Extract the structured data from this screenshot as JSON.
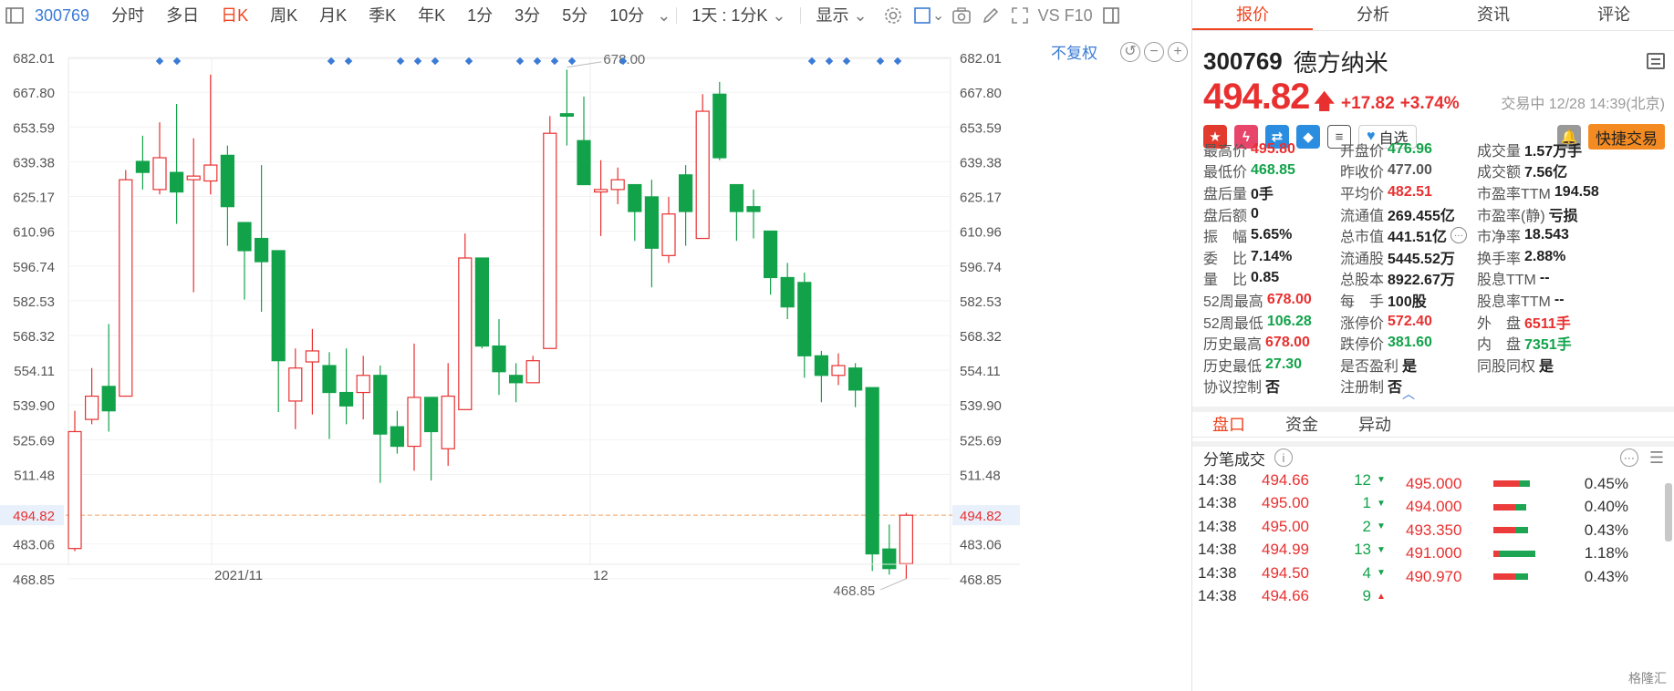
{
  "toolbar": {
    "code": "300769",
    "items": [
      "分时",
      "多日",
      "日K",
      "周K",
      "月K",
      "季K",
      "年K",
      "1分",
      "3分",
      "5分",
      "10分"
    ],
    "active_item": "日K",
    "interval_select": "1天 : 1分K",
    "display_select": "显示",
    "vs_label": "VS F10"
  },
  "chart": {
    "adjust_label": "不复权",
    "price_marker": "494.82",
    "high_label": "678.00",
    "low_label": "468.85",
    "date_labels": [
      "2021/11",
      "12"
    ],
    "y_ticks": [
      "682.01",
      "667.80",
      "653.59",
      "639.38",
      "625.17",
      "610.96",
      "596.74",
      "582.53",
      "568.32",
      "554.11",
      "539.90",
      "525.69",
      "511.48",
      "494.82",
      "483.06",
      "468.85"
    ],
    "colors": {
      "up": "#e93030",
      "down": "#12a34a",
      "marker": "#f0a060",
      "event_dot": "#3a7bd5"
    }
  },
  "chart_data": {
    "type": "candlestick",
    "current_price": 494.82,
    "ylim": [
      461.7,
      689.1
    ],
    "candles": [
      {
        "o": 481.2,
        "h": 537.5,
        "l": 480.1,
        "c": 529.0
      },
      {
        "o": 534.0,
        "h": 555.0,
        "l": 532.0,
        "c": 543.5
      },
      {
        "o": 547.5,
        "h": 573.0,
        "l": 529.0,
        "c": 537.5
      },
      {
        "o": 543.5,
        "h": 636.0,
        "l": 543.5,
        "c": 632.0
      },
      {
        "o": 639.5,
        "h": 650.0,
        "l": 628.0,
        "c": 635.0
      },
      {
        "o": 628.0,
        "h": 655.5,
        "l": 626.0,
        "c": 641.0
      },
      {
        "o": 635.0,
        "h": 663.0,
        "l": 614.0,
        "c": 627.0
      },
      {
        "o": 632.0,
        "h": 649.0,
        "l": 586.0,
        "c": 633.5
      },
      {
        "o": 631.5,
        "h": 675.0,
        "l": 626.0,
        "c": 638.0
      },
      {
        "o": 642.0,
        "h": 646.0,
        "l": 605.0,
        "c": 621.0
      },
      {
        "o": 614.5,
        "h": 614.5,
        "l": 583.0,
        "c": 603.0
      },
      {
        "o": 608.0,
        "h": 638.0,
        "l": 578.0,
        "c": 598.5
      },
      {
        "o": 603.0,
        "h": 603.0,
        "l": 537.0,
        "c": 558.0
      },
      {
        "o": 541.5,
        "h": 563.0,
        "l": 530.0,
        "c": 555.0
      },
      {
        "o": 557.5,
        "h": 571.0,
        "l": 536.0,
        "c": 562.0
      },
      {
        "o": 556.0,
        "h": 561.5,
        "l": 526.0,
        "c": 545.0
      },
      {
        "o": 545.0,
        "h": 563.0,
        "l": 532.0,
        "c": 539.5
      },
      {
        "o": 545.0,
        "h": 560.0,
        "l": 534.0,
        "c": 552.0
      },
      {
        "o": 552.0,
        "h": 556.0,
        "l": 508.0,
        "c": 528.0
      },
      {
        "o": 531.0,
        "h": 537.5,
        "l": 520.0,
        "c": 523.0
      },
      {
        "o": 523.0,
        "h": 565.0,
        "l": 513.0,
        "c": 543.0
      },
      {
        "o": 543.0,
        "h": 543.0,
        "l": 509.0,
        "c": 529.0
      },
      {
        "o": 522.0,
        "h": 557.0,
        "l": 515.0,
        "c": 543.5
      },
      {
        "o": 538.0,
        "h": 610.0,
        "l": 538.0,
        "c": 600.0
      },
      {
        "o": 600.0,
        "h": 600.0,
        "l": 563.0,
        "c": 564.0
      },
      {
        "o": 564.0,
        "h": 575.0,
        "l": 544.0,
        "c": 553.5
      },
      {
        "o": 552.0,
        "h": 557.0,
        "l": 541.0,
        "c": 549.0
      },
      {
        "o": 549.0,
        "h": 560.0,
        "l": 549.0,
        "c": 558.0
      },
      {
        "o": 563.0,
        "h": 658.0,
        "l": 563.0,
        "c": 651.0
      },
      {
        "o": 659.0,
        "h": 677.0,
        "l": 646.0,
        "c": 658.0
      },
      {
        "o": 648.0,
        "h": 666.0,
        "l": 630.0,
        "c": 630.0
      },
      {
        "o": 627.0,
        "h": 640.0,
        "l": 609.0,
        "c": 628.0
      },
      {
        "o": 628.0,
        "h": 637.0,
        "l": 622.0,
        "c": 632.0
      },
      {
        "o": 630.0,
        "h": 630.0,
        "l": 607.0,
        "c": 619.0
      },
      {
        "o": 625.0,
        "h": 632.0,
        "l": 588.0,
        "c": 604.0
      },
      {
        "o": 601.0,
        "h": 625.0,
        "l": 598.0,
        "c": 618.0
      },
      {
        "o": 634.0,
        "h": 638.0,
        "l": 605.0,
        "c": 619.0
      },
      {
        "o": 608.0,
        "h": 667.0,
        "l": 608.0,
        "c": 660.0
      },
      {
        "o": 667.0,
        "h": 672.0,
        "l": 640.0,
        "c": 641.0
      },
      {
        "o": 630.0,
        "h": 630.0,
        "l": 607.0,
        "c": 619.0
      },
      {
        "o": 621.0,
        "h": 628.0,
        "l": 608.0,
        "c": 619.0
      },
      {
        "o": 611.0,
        "h": 611.0,
        "l": 585.0,
        "c": 592.0
      },
      {
        "o": 592.0,
        "h": 598.0,
        "l": 575.0,
        "c": 580.0
      },
      {
        "o": 590.0,
        "h": 594.0,
        "l": 551.0,
        "c": 560.0
      },
      {
        "o": 560.0,
        "h": 562.0,
        "l": 541.0,
        "c": 552.0
      },
      {
        "o": 552.0,
        "h": 561.0,
        "l": 548.0,
        "c": 556.0
      },
      {
        "o": 555.0,
        "h": 557.0,
        "l": 539.0,
        "c": 546.0
      },
      {
        "o": 547.0,
        "h": 547.0,
        "l": 472.0,
        "c": 479.0
      },
      {
        "o": 481.0,
        "h": 491.0,
        "l": 470.5,
        "c": 473.0
      },
      {
        "o": 475.0,
        "h": 495.8,
        "l": 468.85,
        "c": 494.82
      }
    ]
  },
  "tabs": [
    "报价",
    "分析",
    "资讯",
    "评论"
  ],
  "active_tab": "报价",
  "stock": {
    "code": "300769",
    "name": "德方纳米",
    "price": "494.82",
    "change": "+17.82",
    "change_pct": "+3.74%",
    "status": "交易中 12/28 14:39(北京)",
    "fav_label": "自选",
    "quick_trade": "快捷交易"
  },
  "stats": [
    [
      {
        "label": "最高价",
        "value": "495.80",
        "tone": "up"
      },
      {
        "label": "开盘价",
        "value": "476.96",
        "tone": "down"
      },
      {
        "label": "成交量",
        "value": "1.57万手",
        "tone": ""
      }
    ],
    [
      {
        "label": "最低价",
        "value": "468.85",
        "tone": "down"
      },
      {
        "label": "昨收价",
        "value": "477.00",
        "tone": "flat"
      },
      {
        "label": "成交额",
        "value": "7.56亿",
        "tone": ""
      }
    ],
    [
      {
        "label": "盘后量",
        "value": "0手",
        "tone": ""
      },
      {
        "label": "平均价",
        "value": "482.51",
        "tone": "up"
      },
      {
        "label": "市盈率TTM",
        "value": "194.58",
        "tone": ""
      }
    ],
    [
      {
        "label": "盘后额",
        "value": "0",
        "tone": ""
      },
      {
        "label": "流通值",
        "value": "269.455亿",
        "tone": ""
      },
      {
        "label": "市盈率(静)",
        "value": "亏损",
        "tone": ""
      }
    ],
    [
      {
        "label": "振　幅",
        "value": "5.65%",
        "tone": ""
      },
      {
        "label": "总市值",
        "value": "441.51亿",
        "tone": ""
      },
      {
        "label": "市净率",
        "value": "18.543",
        "tone": ""
      }
    ],
    [
      {
        "label": "委　比",
        "value": "7.14%",
        "tone": ""
      },
      {
        "label": "流通股",
        "value": "5445.52万",
        "tone": ""
      },
      {
        "label": "换手率",
        "value": "2.88%",
        "tone": ""
      }
    ],
    [
      {
        "label": "量　比",
        "value": "0.85",
        "tone": ""
      },
      {
        "label": "总股本",
        "value": "8922.67万",
        "tone": ""
      },
      {
        "label": "股息TTM",
        "value": "--",
        "tone": ""
      }
    ],
    [
      {
        "label": "52周最高",
        "value": "678.00",
        "tone": "up"
      },
      {
        "label": "每　手",
        "value": "100股",
        "tone": ""
      },
      {
        "label": "股息率TTM",
        "value": "--",
        "tone": ""
      }
    ],
    [
      {
        "label": "52周最低",
        "value": "106.28",
        "tone": "down"
      },
      {
        "label": "涨停价",
        "value": "572.40",
        "tone": "up"
      },
      {
        "label": "外　盘",
        "value": "6511手",
        "tone": "up"
      }
    ],
    [
      {
        "label": "历史最高",
        "value": "678.00",
        "tone": "up"
      },
      {
        "label": "跌停价",
        "value": "381.60",
        "tone": "down"
      },
      {
        "label": "内　盘",
        "value": "7351手",
        "tone": "down"
      }
    ],
    [
      {
        "label": "历史最低",
        "value": "27.30",
        "tone": "down"
      },
      {
        "label": "是否盈利",
        "value": "是",
        "tone": ""
      },
      {
        "label": "同股同权",
        "value": "是",
        "tone": ""
      }
    ],
    [
      {
        "label": "协议控制",
        "value": "否",
        "tone": ""
      },
      {
        "label": "注册制",
        "value": "否",
        "tone": ""
      },
      {
        "label": "",
        "value": "",
        "tone": ""
      }
    ]
  ],
  "sub_tabs": [
    "盘口",
    "资金",
    "异动"
  ],
  "active_sub_tab": "盘口",
  "tick_header": "分笔成交",
  "ticks": [
    {
      "time": "14:38",
      "price": "494.66",
      "vol": "12",
      "dir": "down"
    },
    {
      "time": "14:38",
      "price": "495.00",
      "vol": "1",
      "dir": "down"
    },
    {
      "time": "14:38",
      "price": "495.00",
      "vol": "2",
      "dir": "down"
    },
    {
      "time": "14:38",
      "price": "494.99",
      "vol": "13",
      "dir": "down"
    },
    {
      "time": "14:38",
      "price": "494.50",
      "vol": "4",
      "dir": "down"
    },
    {
      "time": "14:38",
      "price": "494.66",
      "vol": "9",
      "dir": "up"
    }
  ],
  "book": [
    {
      "price": "495.000",
      "pct": "0.45%",
      "red": 0.7,
      "green": 0.3
    },
    {
      "price": "494.000",
      "pct": "0.40%",
      "red": 0.6,
      "green": 0.3
    },
    {
      "price": "493.350",
      "pct": "0.43%",
      "red": 0.6,
      "green": 0.35
    },
    {
      "price": "491.000",
      "pct": "1.18%",
      "red": 0.15,
      "green": 1.0
    },
    {
      "price": "490.970",
      "pct": "0.43%",
      "red": 0.6,
      "green": 0.35
    }
  ],
  "watermark": "格隆汇"
}
